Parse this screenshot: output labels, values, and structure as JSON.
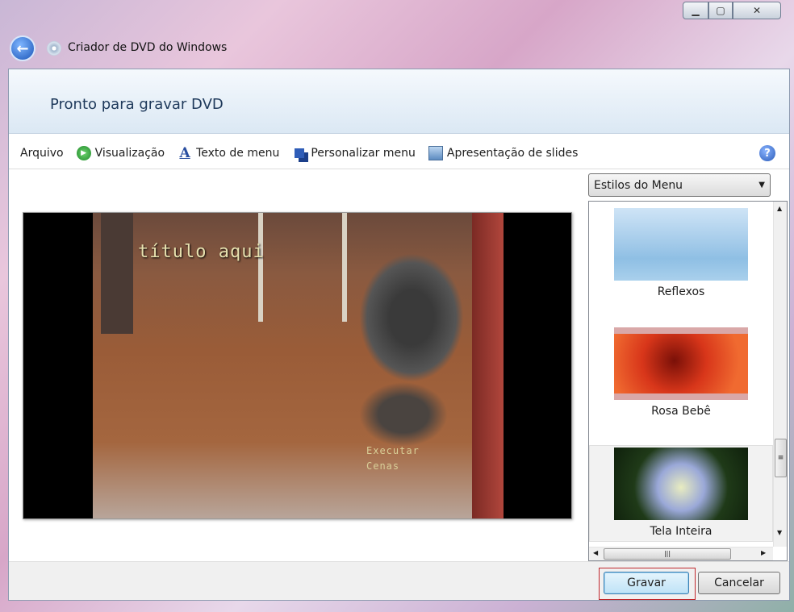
{
  "window": {
    "title": "Criador de DVD do Windows",
    "minimize": "▁",
    "maximize": "▢",
    "close": "✕"
  },
  "header": {
    "title": "Pronto para gravar DVD"
  },
  "toolbar": {
    "items": [
      {
        "label": "Arquivo",
        "icon": ""
      },
      {
        "label": "Visualização",
        "icon": "play-icon"
      },
      {
        "label": "Texto de menu",
        "icon": "text-a-icon"
      },
      {
        "label": "Personalizar menu",
        "icon": "customize-icon"
      },
      {
        "label": "Apresentação de slides",
        "icon": "slideshow-icon"
      }
    ],
    "help": "?"
  },
  "preview": {
    "menu_title": "título aqui",
    "play_line1": "Executar",
    "play_line2": "Cenas"
  },
  "styles": {
    "dropdown": "Estilos do Menu",
    "items": [
      "Reflexos",
      "Rosa Bebê",
      "Tela Inteira"
    ],
    "selected": "Tela Inteira"
  },
  "footer": {
    "burn": "Gravar",
    "cancel": "Cancelar"
  }
}
